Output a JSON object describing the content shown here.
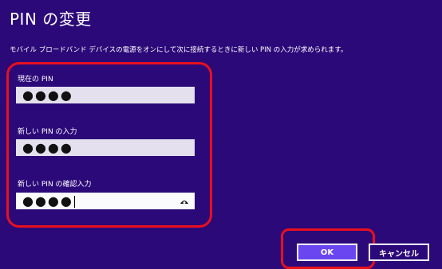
{
  "dialog": {
    "title": "PIN の変更",
    "description": "モバイル ブロードバンド デバイスの電源をオンにして次に接続するときに新しい PIN の入力が求められます。"
  },
  "fields": [
    {
      "label": "現在の PIN",
      "value": "●●●●"
    },
    {
      "label": "新しい PIN の入力",
      "value": "●●●●"
    },
    {
      "label": "新しい PIN の確認入力",
      "value": "●●●●"
    }
  ],
  "buttons": {
    "ok_label": "OK",
    "cancel_label": "キャンセル"
  },
  "colors": {
    "background": "#2c0979",
    "primary_button": "#6a46f0",
    "annotation": "#e8101e",
    "input_bg": "#e4e0ee"
  },
  "icons": {
    "reveal": "eye-icon"
  }
}
